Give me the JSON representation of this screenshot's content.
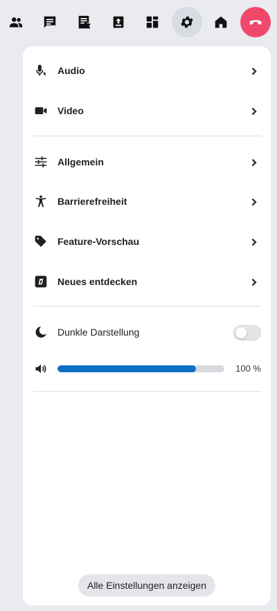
{
  "toolbar": {
    "buttons": [
      {
        "name": "participants-icon"
      },
      {
        "name": "chat-icon"
      },
      {
        "name": "notes-icon"
      },
      {
        "name": "upload-icon"
      },
      {
        "name": "apps-icon"
      },
      {
        "name": "gear-icon",
        "active": true
      },
      {
        "name": "home-icon"
      },
      {
        "name": "hangup-icon"
      }
    ],
    "hangup_color": "#f0486a"
  },
  "menu": {
    "audio": {
      "label": "Audio",
      "icon": "microphone-icon"
    },
    "video": {
      "label": "Video",
      "icon": "video-camera-icon"
    },
    "general": {
      "label": "Allgemein",
      "icon": "sliders-icon"
    },
    "accessibility": {
      "label": "Barrierefreiheit",
      "icon": "accessibility-icon"
    },
    "feature_preview": {
      "label": "Feature-Vorschau",
      "icon": "tag-icon"
    },
    "discover": {
      "label": "Neues entdecken",
      "icon": "discover-icon"
    }
  },
  "dark_mode": {
    "label": "Dunkle Darstellung",
    "enabled": false,
    "icon": "moon-icon"
  },
  "volume": {
    "percent_text": "100 %",
    "slider_fill": 0.83,
    "icon": "speaker-icon",
    "accent": "#0f6fc6"
  },
  "footer": {
    "all_settings_label": "Alle Einstellungen anzeigen"
  }
}
